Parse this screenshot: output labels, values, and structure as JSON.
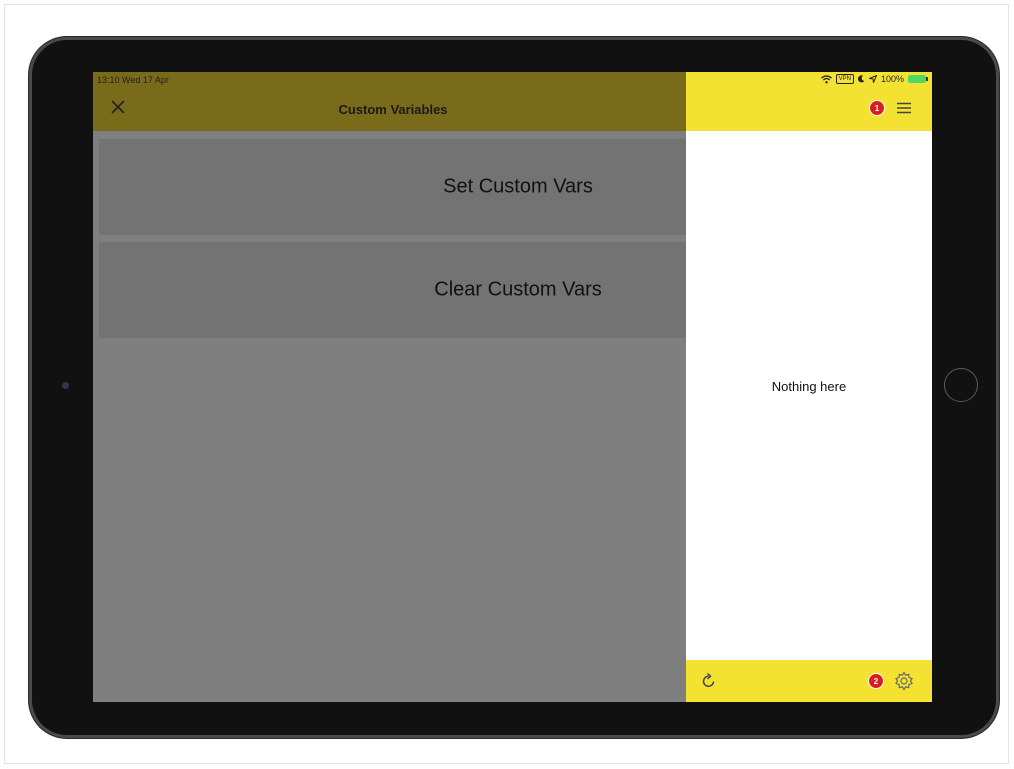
{
  "status_bar": {
    "time_date": "13:10  Wed 17 Apr",
    "vpn": "VPN",
    "battery": "100%"
  },
  "header": {
    "title": "Custom Variables"
  },
  "actions": [
    {
      "label": "Set Custom Vars"
    },
    {
      "label": "Clear Custom Vars"
    }
  ],
  "side_panel": {
    "empty_text": "Nothing here",
    "markers": [
      "1",
      "2"
    ]
  },
  "icons": {
    "close": "close-icon",
    "menu": "menu-icon",
    "refresh": "refresh-icon",
    "settings": "gear-icon",
    "wifi": "wifi-icon",
    "moon": "moon-icon",
    "location": "location-icon",
    "battery": "battery-icon"
  },
  "colors": {
    "header_dimmed": "#796b1a",
    "header_accent": "#f4e232",
    "overlay_gray": "#7f7f7f",
    "marker_red": "#d81e1e"
  }
}
